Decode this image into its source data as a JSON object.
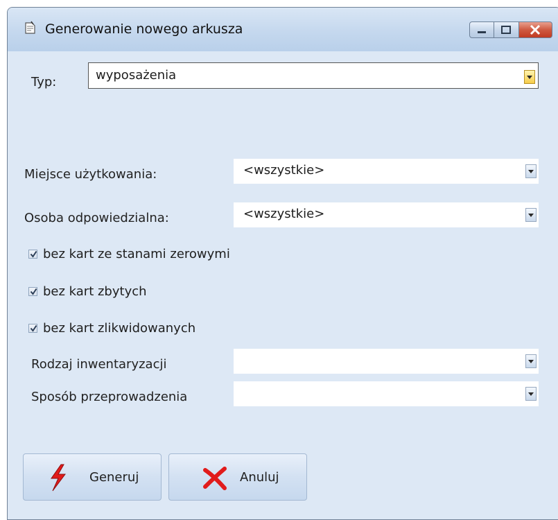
{
  "window": {
    "title": "Generowanie nowego arkusza"
  },
  "typ": {
    "label": "Typ:",
    "value": "wyposażenia"
  },
  "fields": {
    "miejsce": {
      "label": "Miejsce użytkowania:",
      "value": "<wszystkie>"
    },
    "osoba": {
      "label": "Osoba odpowiedzialna:",
      "value": "<wszystkie>"
    },
    "rodzaj": {
      "label": "Rodzaj inwentaryzacji",
      "value": ""
    },
    "sposob": {
      "label": "Sposób przeprowadzenia",
      "value": ""
    }
  },
  "checks": {
    "zero": {
      "label": "bez kart ze stanami zerowymi",
      "checked": true
    },
    "zbyte": {
      "label": "bez kart zbytych",
      "checked": true
    },
    "zlikw": {
      "label": "bez kart zlikwidowanych",
      "checked": true
    }
  },
  "buttons": {
    "generuj": "Generuj",
    "anuluj": "Anuluj"
  },
  "colors": {
    "window_bg": "#dde8f5",
    "accent_red": "#e11b1b",
    "typ_arrow": "#f7cd4a"
  },
  "icons": {
    "title": "sheet-icon",
    "generate": "lightning-icon",
    "cancel": "x-cross-icon"
  }
}
